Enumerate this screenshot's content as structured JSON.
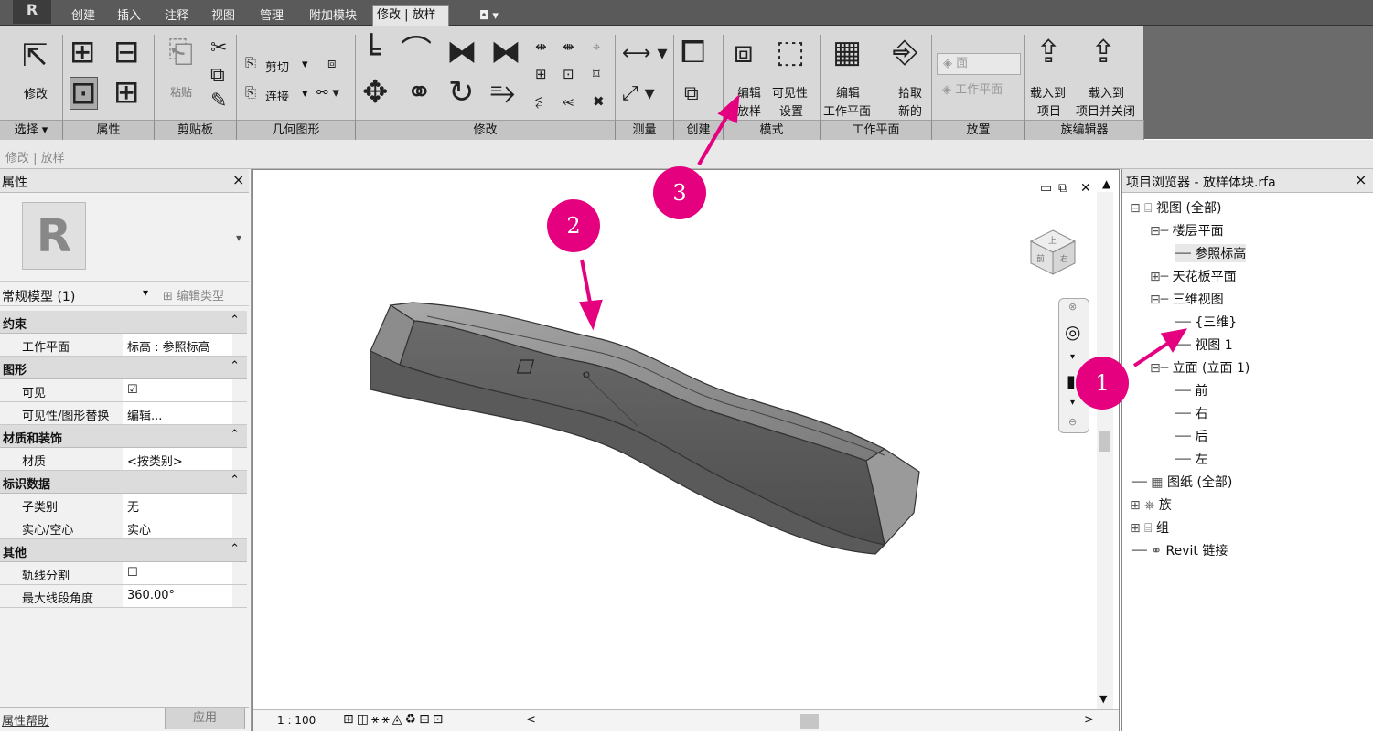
{
  "tabs": [
    "创建",
    "插入",
    "注释",
    "视图",
    "管理",
    "附加模块",
    "修改 | 放样"
  ],
  "tab_extra": "◘ ▾",
  "ribbon": {
    "modify_label": "修改",
    "paste_label": "粘贴",
    "cut_label": "剪切",
    "join_label": "连接",
    "edit_loft": [
      "编辑",
      "放样"
    ],
    "visibility": [
      "可见性",
      "设置"
    ],
    "edit_workplane": [
      "编辑",
      "工作平面"
    ],
    "pick_new": [
      "拾取",
      "新的"
    ],
    "place_face": "面",
    "place_workplane": "工作平面",
    "load_project": [
      "载入到",
      "项目"
    ],
    "load_close": [
      "载入到",
      "项目并关闭"
    ]
  },
  "panels": [
    "选择 ▾",
    "属性",
    "剪贴板",
    "几何图形",
    "修改",
    "测量",
    "创建",
    "模式",
    "工作平面",
    "放置",
    "族编辑器"
  ],
  "context_path": "修改 | 放样",
  "properties": {
    "title": "属性",
    "close": "×",
    "type_name": "常规模型 (1)",
    "edit_type": "编辑类型",
    "sections": [
      {
        "name": "约束",
        "rows": [
          {
            "k": "工作平面",
            "v": "标高 : 参照标高"
          }
        ]
      },
      {
        "name": "图形",
        "rows": [
          {
            "k": "可见",
            "v": "☑"
          },
          {
            "k": "可见性/图形替换",
            "v": "编辑..."
          }
        ]
      },
      {
        "name": "材质和装饰",
        "rows": [
          {
            "k": "材质",
            "v": "<按类别>"
          }
        ]
      },
      {
        "name": "标识数据",
        "rows": [
          {
            "k": "子类别",
            "v": "无"
          },
          {
            "k": "实心/空心",
            "v": "实心"
          }
        ]
      },
      {
        "name": "其他",
        "rows": [
          {
            "k": "轨线分割",
            "v": "☐"
          },
          {
            "k": "最大线段角度",
            "v": "360.00°"
          }
        ]
      }
    ],
    "help": "属性帮助",
    "apply": "应用"
  },
  "viewport": {
    "scale": "1 : 100",
    "nav_left": "<",
    "nav_right": ">",
    "viewcube": [
      "上",
      "前",
      "右"
    ]
  },
  "browser": {
    "title": "项目浏览器 - 放样体块.rfa",
    "close": "×",
    "items": [
      "视图 (全部)",
      "楼层平面",
      "参照标高",
      "天花板平面",
      "三维视图",
      "{三维}",
      "视图 1",
      "立面 (立面 1)",
      "前",
      "右",
      "后",
      "左",
      "图纸 (全部)",
      "族",
      "组",
      "Revit 链接"
    ]
  },
  "callouts": [
    "1",
    "2",
    "3"
  ],
  "colors": {
    "callout": "#e4007f",
    "tabbar": "#5a5a5a",
    "ribbon": "#d8d8d8"
  }
}
